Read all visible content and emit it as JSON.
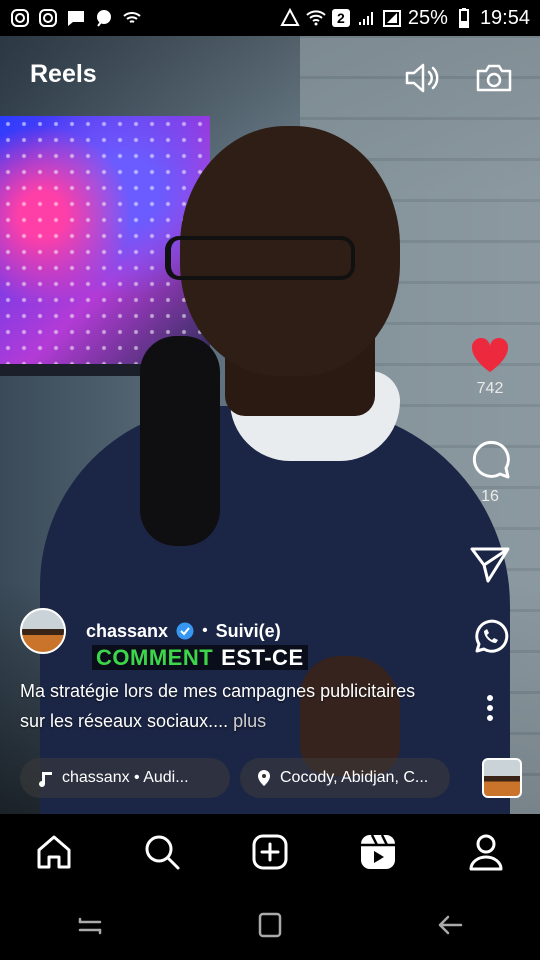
{
  "status_bar": {
    "battery": "25%",
    "time": "19:54",
    "sim_badge": "2"
  },
  "header": {
    "title": "Reels"
  },
  "video": {
    "overlay_word_1": "COMMENT",
    "overlay_word_2": "EST-CE"
  },
  "rail": {
    "likes": "742",
    "comments": "16"
  },
  "post": {
    "username": "chassanx",
    "separator": "•",
    "follow_status": "Suivi(e)",
    "caption": "Ma stratégie lors de mes campagnes publicitaires sur les réseaux sociaux....",
    "more_label": "plus"
  },
  "chips": {
    "audio": "chassanx • Audi...",
    "location": "Cocody, Abidjan, C..."
  },
  "colors": {
    "like_red": "#ed2a3d",
    "verified_blue": "#3797f0",
    "overlay_green": "#3dd64a"
  }
}
